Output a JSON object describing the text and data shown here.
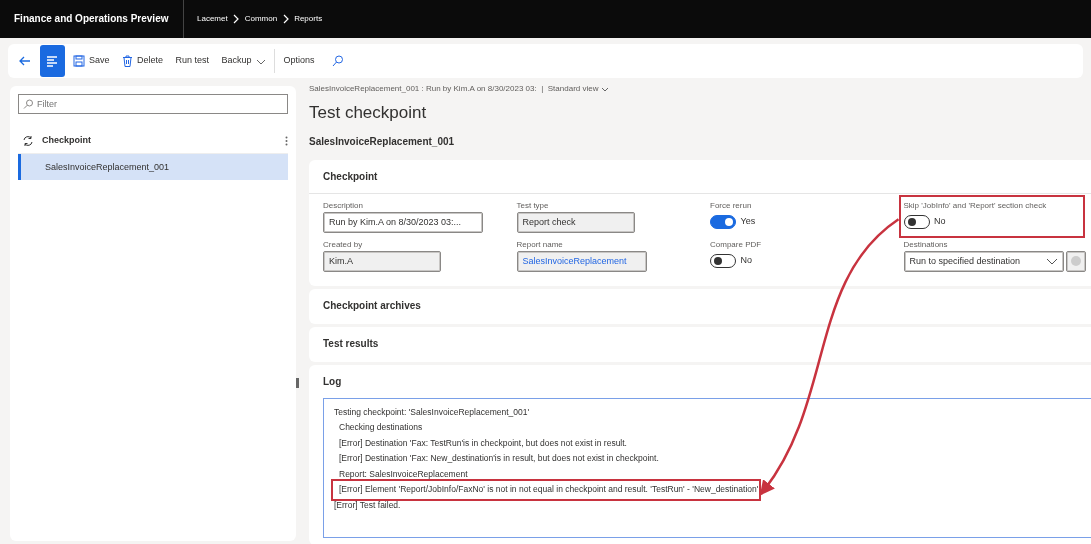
{
  "app": {
    "title": "Finance and Operations Preview",
    "breadcrumb": [
      "Lacemet",
      "Common",
      "Reports"
    ]
  },
  "toolbar": [
    {
      "kind": "back"
    },
    {
      "kind": "panel-toggle"
    },
    {
      "kind": "save",
      "label": "Save"
    },
    {
      "kind": "delete",
      "label": "Delete"
    },
    {
      "kind": "plain",
      "label": "Run test"
    },
    {
      "kind": "menu",
      "label": "Backup"
    },
    {
      "kind": "divider"
    },
    {
      "kind": "plain",
      "label": "Options"
    },
    {
      "kind": "search"
    }
  ],
  "list": {
    "filter_placeholder": "Filter",
    "column": "Checkpoint",
    "rows": [
      {
        "label": "SalesInvoiceReplacement_001",
        "selected": true
      }
    ]
  },
  "header": {
    "context": "SalesInvoiceReplacement_001 : Run by Kim.A on 8/30/2023 03:",
    "separator": "|",
    "view": "Standard view",
    "title": "Test checkpoint",
    "subtitle": "SalesInvoiceReplacement_001"
  },
  "checkpoint": {
    "title": "Checkpoint",
    "columns": [
      [
        {
          "kind": "text",
          "label": "Description",
          "value": "Run by Kim.A on 8/30/2023 03:...",
          "readonly": false
        },
        {
          "kind": "text",
          "label": "Created by",
          "value": "Kim.A",
          "readonly": true
        }
      ],
      [
        {
          "kind": "text",
          "label": "Test type",
          "value": "Report check",
          "readonly": true
        },
        {
          "kind": "link",
          "label": "Report name",
          "value": "SalesInvoiceReplacement",
          "readonly": true
        }
      ],
      [
        {
          "kind": "toggle",
          "label": "Force rerun",
          "on": true,
          "value": "Yes"
        },
        {
          "kind": "toggle",
          "label": "Compare PDF",
          "on": false,
          "value": "No"
        }
      ],
      [
        {
          "kind": "toggle",
          "label": "Skip 'JobInfo' and 'Report' section check",
          "on": false,
          "value": "No",
          "highlighted": true
        },
        {
          "kind": "select",
          "label": "Destinations",
          "value": "Run to specified destination"
        }
      ]
    ]
  },
  "sections": [
    {
      "title": "Checkpoint archives"
    },
    {
      "title": "Test results"
    }
  ],
  "log": {
    "title": "Log",
    "lines": [
      {
        "text": "Testing checkpoint: 'SalesInvoiceReplacement_001'",
        "indent": false,
        "highlighted": false
      },
      {
        "text": "Checking destinations",
        "indent": true,
        "highlighted": false
      },
      {
        "text": "[Error] Destination 'Fax: TestRun'is in checkpoint, but does not exist in result.",
        "indent": true,
        "highlighted": false
      },
      {
        "text": "[Error] Destination 'Fax: New_destination'is in result, but does not exist in checkpoint.",
        "indent": true,
        "highlighted": false
      },
      {
        "text": "Report: SalesInvoiceReplacement",
        "indent": true,
        "highlighted": false
      },
      {
        "text": "[Error] Element 'Report/JobInfo/FaxNo' is not in not equal in checkpoint and result. 'TestRun' - 'New_destination'",
        "indent": true,
        "highlighted": true
      },
      {
        "text": "[Error] Test failed.",
        "indent": false,
        "highlighted": false
      }
    ]
  }
}
